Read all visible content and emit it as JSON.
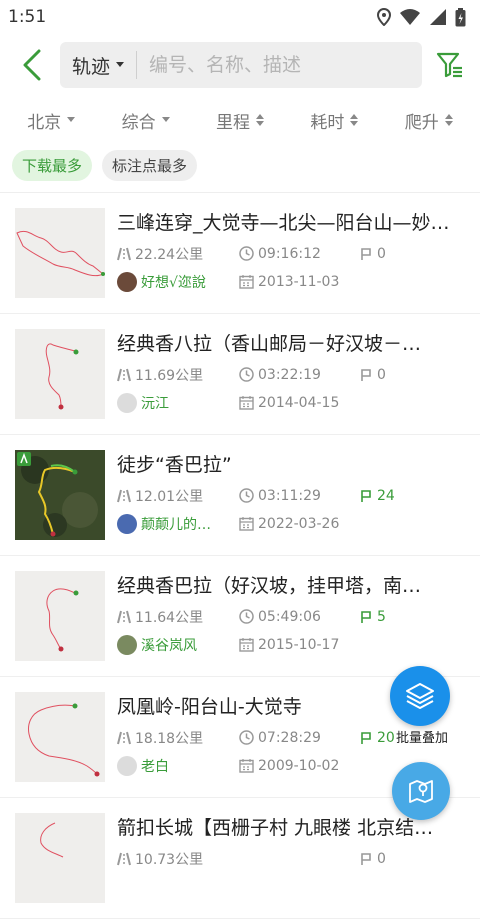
{
  "status": {
    "time": "1:51"
  },
  "search": {
    "type_label": "轨迹",
    "placeholder": "编号、名称、描述"
  },
  "sort": [
    {
      "label": "北京"
    },
    {
      "label": "综合"
    },
    {
      "label": "里程"
    },
    {
      "label": "耗时"
    },
    {
      "label": "爬升"
    }
  ],
  "chips": [
    {
      "label": "下载最多",
      "active": true
    },
    {
      "label": "标注点最多",
      "active": false
    }
  ],
  "tracks": [
    {
      "title": "三峰连穿_大觉寺—北尖—阳台山—妙…",
      "distance": "22.24公里",
      "duration": "09:16:12",
      "points": "0",
      "author": "好想√迩說",
      "date": "2013-11-03"
    },
    {
      "title": "经典香八拉（香山邮局－好汉坡－…",
      "distance": "11.69公里",
      "duration": "03:22:19",
      "points": "0",
      "author": "沅江",
      "date": "2014-04-15"
    },
    {
      "title": "徒步“香巴拉”",
      "distance": "12.01公里",
      "duration": "03:11:29",
      "points": "24",
      "author": "颠颠儿的…",
      "date": "2022-03-26"
    },
    {
      "title": "经典香巴拉（好汉坡，挂甲塔，南…",
      "distance": "11.64公里",
      "duration": "05:49:06",
      "points": "5",
      "author": "溪谷岚风",
      "date": "2015-10-17"
    },
    {
      "title": "凤凰岭-阳台山-大觉寺",
      "distance": "18.18公里",
      "duration": "07:28:29",
      "points": "20",
      "author": "老白",
      "date": "2009-10-02"
    },
    {
      "title": "箭扣长城【西栅子村 九眼楼 北京结…",
      "distance": "10.73公里",
      "duration": "",
      "points": "0",
      "author": "",
      "date": ""
    }
  ],
  "fab": {
    "batch_label": "批量叠加"
  },
  "colors": {
    "accent_green": "#3a9c3a",
    "fab_blue": "#1a90ea",
    "fab_light_blue": "#48a9e6"
  }
}
